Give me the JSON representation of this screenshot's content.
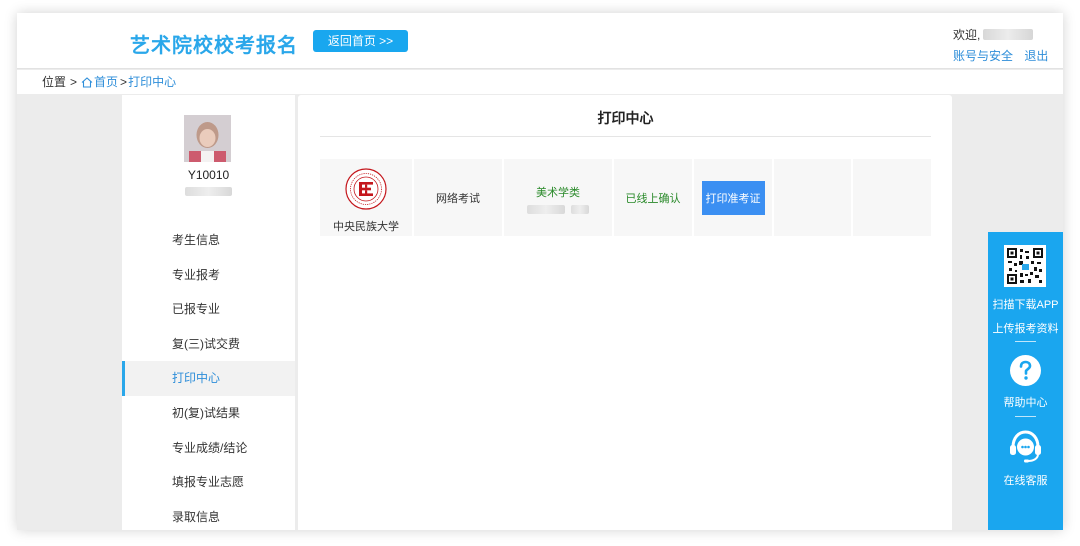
{
  "header": {
    "site_title": "艺术院校校考报名",
    "home_button": "返回首页 >>",
    "welcome": "欢迎,",
    "account_link": "账号与安全",
    "logout_link": "退出"
  },
  "breadcrumb": {
    "position_label": "位置",
    "sep1": ">",
    "home": "首页",
    "sep2": ">",
    "current": "打印中心"
  },
  "sidebar": {
    "student_id": "Y10010",
    "menu": [
      "考生信息",
      "专业报考",
      "已报专业",
      "复(三)试交费",
      "打印中心",
      "初(复)试结果",
      "专业成绩/结论",
      "填报专业志愿",
      "录取信息"
    ],
    "active_index": 4
  },
  "content": {
    "title": "打印中心",
    "rows": [
      {
        "school": "中央民族大学",
        "exam_type": "网络考试",
        "major": "美术学类",
        "status": "已线上确认",
        "action": "打印准考证"
      }
    ]
  },
  "floatbar": {
    "scan_text": "扫描下载APP",
    "upload_text": "上传报考资料",
    "help_text": "帮助中心",
    "service_text": "在线客服"
  },
  "colors": {
    "accent": "#1aa6ef",
    "link": "#2e8ed9",
    "status_green": "#2a8a2a",
    "button_blue": "#3b8ff2"
  }
}
